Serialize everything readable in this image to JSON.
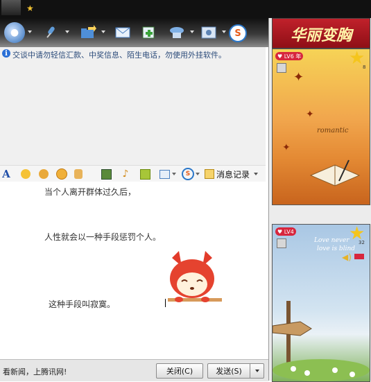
{
  "notice": {
    "text": "交谈中请勿轻信汇款、中奖信息、陌生电话，勿使用外挂软件。"
  },
  "toolbar": {
    "items": [
      {
        "icon": "webcam-icon"
      },
      {
        "icon": "microphone-icon"
      },
      {
        "icon": "folder-send-icon"
      },
      {
        "icon": "email-icon"
      },
      {
        "icon": "add-app-icon"
      },
      {
        "icon": "member-icon"
      },
      {
        "icon": "settings-icon"
      },
      {
        "icon": "soso-icon"
      }
    ]
  },
  "format_bar": {
    "font_label": "A",
    "history_label": "消息记录"
  },
  "chat": {
    "messages": [
      "当个人离开群体过久后，",
      "人性就会以一种手段惩罚个人。",
      "这种手段叫寂寞。"
    ]
  },
  "status": {
    "text": "看新闻，上腾讯网!"
  },
  "buttons": {
    "close": "关闭(C)",
    "send": "发送(S)"
  },
  "right": {
    "ad_title": "华丽变胸",
    "show1": {
      "level_label": "LV6",
      "level_extra": "年",
      "star_count": "8",
      "art_text": "romantic"
    },
    "show2": {
      "level_label": "LV4",
      "star_count": "32",
      "art_text_1": "Love never",
      "art_text_2": "love is blind"
    }
  }
}
